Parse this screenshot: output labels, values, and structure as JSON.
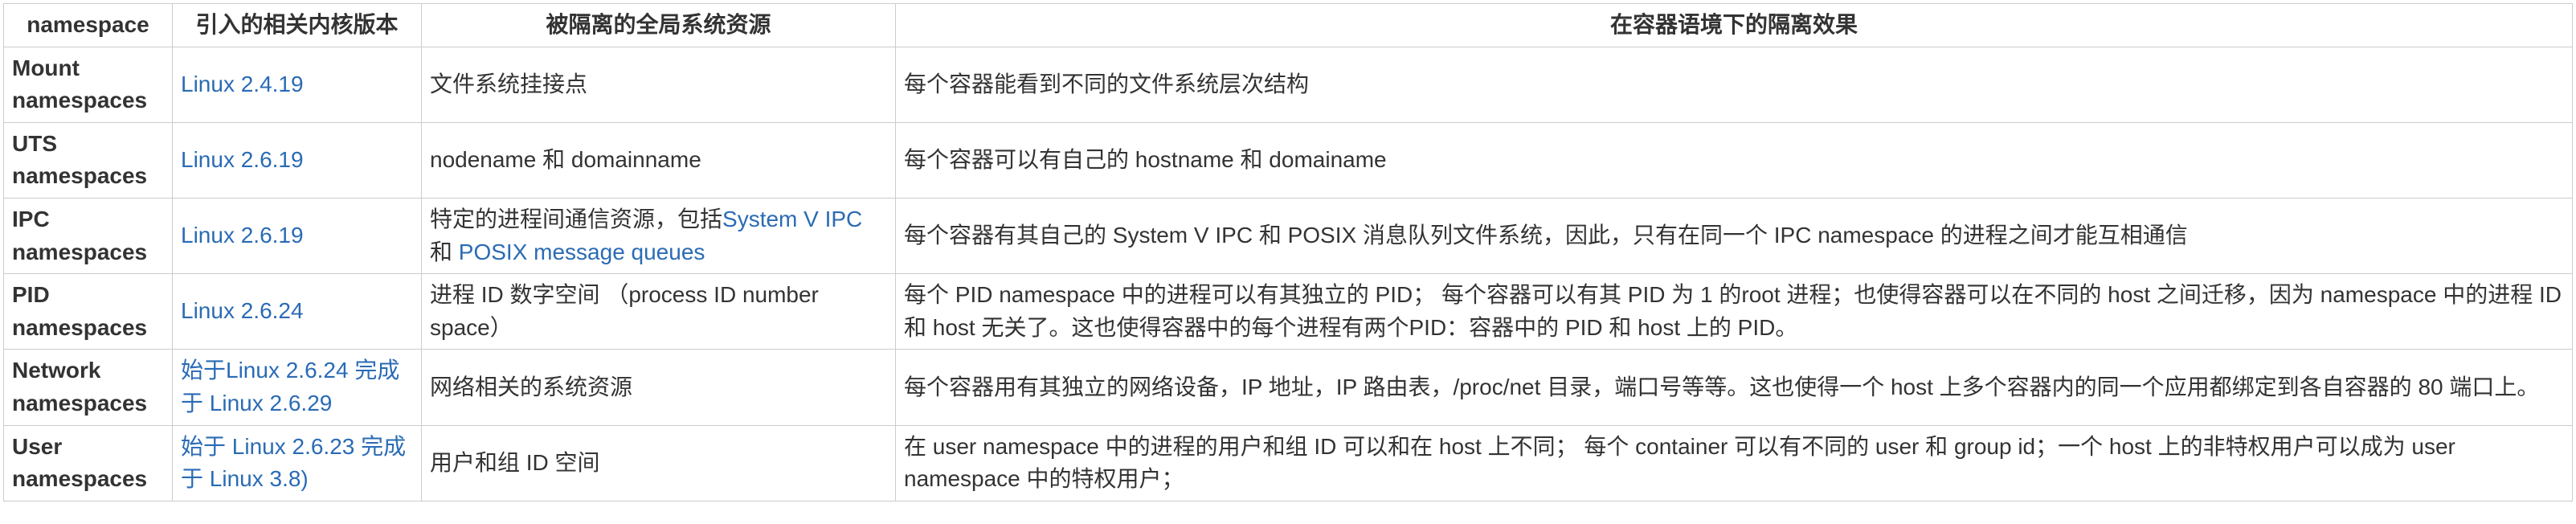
{
  "headers": {
    "namespace": "namespace",
    "kernel_version": "引入的相关内核版本",
    "isolated_resource": "被隔离的全局系统资源",
    "container_effect": "在容器语境下的隔离效果"
  },
  "rows": [
    {
      "name": "Mount namespaces",
      "version_links": [
        {
          "text": "Linux 2.4.19"
        }
      ],
      "resource_parts": [
        {
          "text": "文件系统挂接点",
          "link": false
        }
      ],
      "effect": "每个容器能看到不同的文件系统层次结构"
    },
    {
      "name": "UTS namespaces",
      "version_links": [
        {
          "text": "Linux 2.6.19"
        }
      ],
      "resource_parts": [
        {
          "text": "nodename 和 domainname",
          "link": false
        }
      ],
      "effect": "每个容器可以有自己的 hostname 和 domainame"
    },
    {
      "name": "IPC namespaces",
      "version_links": [
        {
          "text": "Linux 2.6.19"
        }
      ],
      "resource_parts": [
        {
          "text": "特定的进程间通信资源，包括",
          "link": false
        },
        {
          "text": "System V IPC",
          "link": true
        },
        {
          "text": " 和  ",
          "link": false
        },
        {
          "text": "POSIX message queues",
          "link": true
        }
      ],
      "effect": "每个容器有其自己的 System V IPC 和 POSIX 消息队列文件系统，因此，只有在同一个 IPC namespace 的进程之间才能互相通信"
    },
    {
      "name": "PID namespaces",
      "version_links": [
        {
          "text": "Linux 2.6.24"
        }
      ],
      "resource_parts": [
        {
          "text": "进程 ID 数字空间 （process ID number space）",
          "link": false
        }
      ],
      "effect": "每个 PID namespace 中的进程可以有其独立的 PID； 每个容器可以有其 PID 为 1 的root 进程；也使得容器可以在不同的 host 之间迁移，因为 namespace 中的进程 ID 和 host 无关了。这也使得容器中的每个进程有两个PID：容器中的 PID 和 host 上的 PID。"
    },
    {
      "name": "Network namespaces",
      "version_links": [
        {
          "text": "始于Linux 2.6.24 完成于 Linux 2.6.29"
        }
      ],
      "resource_parts": [
        {
          "text": "网络相关的系统资源",
          "link": false
        }
      ],
      "effect": "每个容器用有其独立的网络设备，IP 地址，IP 路由表，/proc/net 目录，端口号等等。这也使得一个 host 上多个容器内的同一个应用都绑定到各自容器的 80 端口上。"
    },
    {
      "name": "User namespaces",
      "version_links": [
        {
          "text": "始于 Linux 2.6.23 完成于 Linux 3.8)"
        }
      ],
      "resource_parts": [
        {
          "text": "用户和组 ID 空间",
          "link": false
        }
      ],
      "effect": " 在 user namespace 中的进程的用户和组 ID 可以和在 host 上不同； 每个 container 可以有不同的 user 和 group id；一个 host 上的非特权用户可以成为 user namespace 中的特权用户；"
    }
  ]
}
